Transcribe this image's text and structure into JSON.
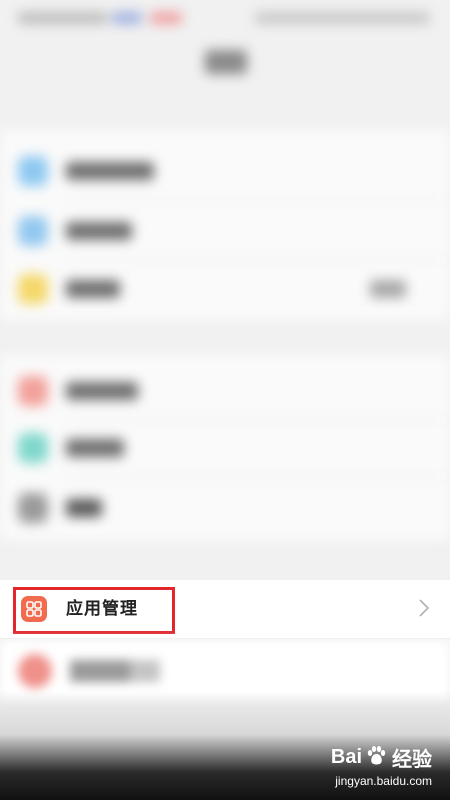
{
  "app_list": {
    "highlighted_item": {
      "label": "应用管理",
      "icon": "app-grid-icon",
      "icon_color": "#f26b4f"
    }
  },
  "highlight_color": "#e2262b",
  "watermark": {
    "brand_left": "Bai",
    "brand_right": "经验",
    "url": "jingyan.baidu.com",
    "icon": "baidu-paw-icon"
  }
}
